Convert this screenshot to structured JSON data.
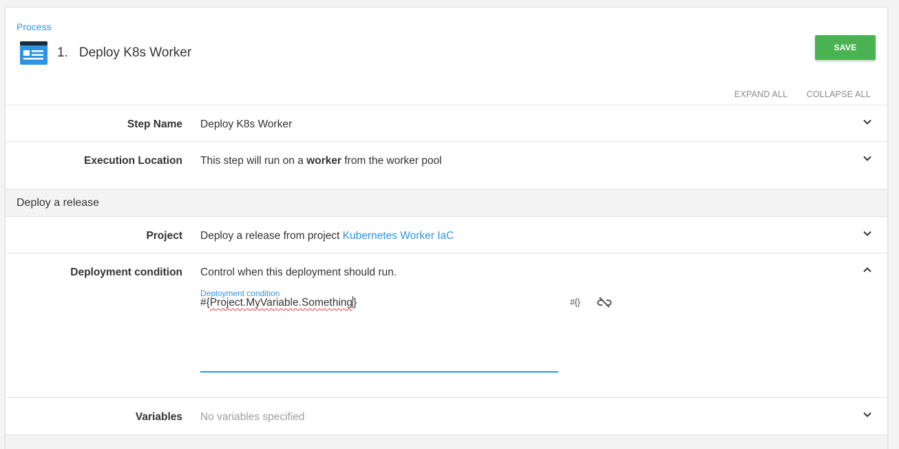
{
  "breadcrumb": "Process",
  "step": {
    "number": "1.",
    "title": "Deploy K8s Worker",
    "icon": "step-window-icon"
  },
  "save_label": "SAVE",
  "actions": {
    "expand_all": "EXPAND ALL",
    "collapse_all": "COLLAPSE ALL"
  },
  "rows": {
    "step_name": {
      "label": "Step Name",
      "value": "Deploy K8s Worker"
    },
    "execution_location": {
      "label": "Execution Location",
      "value_before": "This step will run on a",
      "value_bold": "worker",
      "value_after": "from the worker pool"
    },
    "project": {
      "label": "Project",
      "value_before": "Deploy a release from project",
      "value_link": "Kubernetes Worker IaC"
    },
    "deployment_condition": {
      "label": "Deployment condition",
      "value": "Control when this deployment should run.",
      "field_label": "Deployment condition",
      "field_prefix": "#{",
      "field_text": "Project.MyVariable.Something",
      "field_suffix": "}",
      "variable_button": "#{}"
    },
    "variables": {
      "label": "Variables",
      "value": "No variables specified"
    }
  },
  "section_title": "Deploy a release",
  "colors": {
    "accent": "#2f93e0",
    "save": "#48b350"
  }
}
